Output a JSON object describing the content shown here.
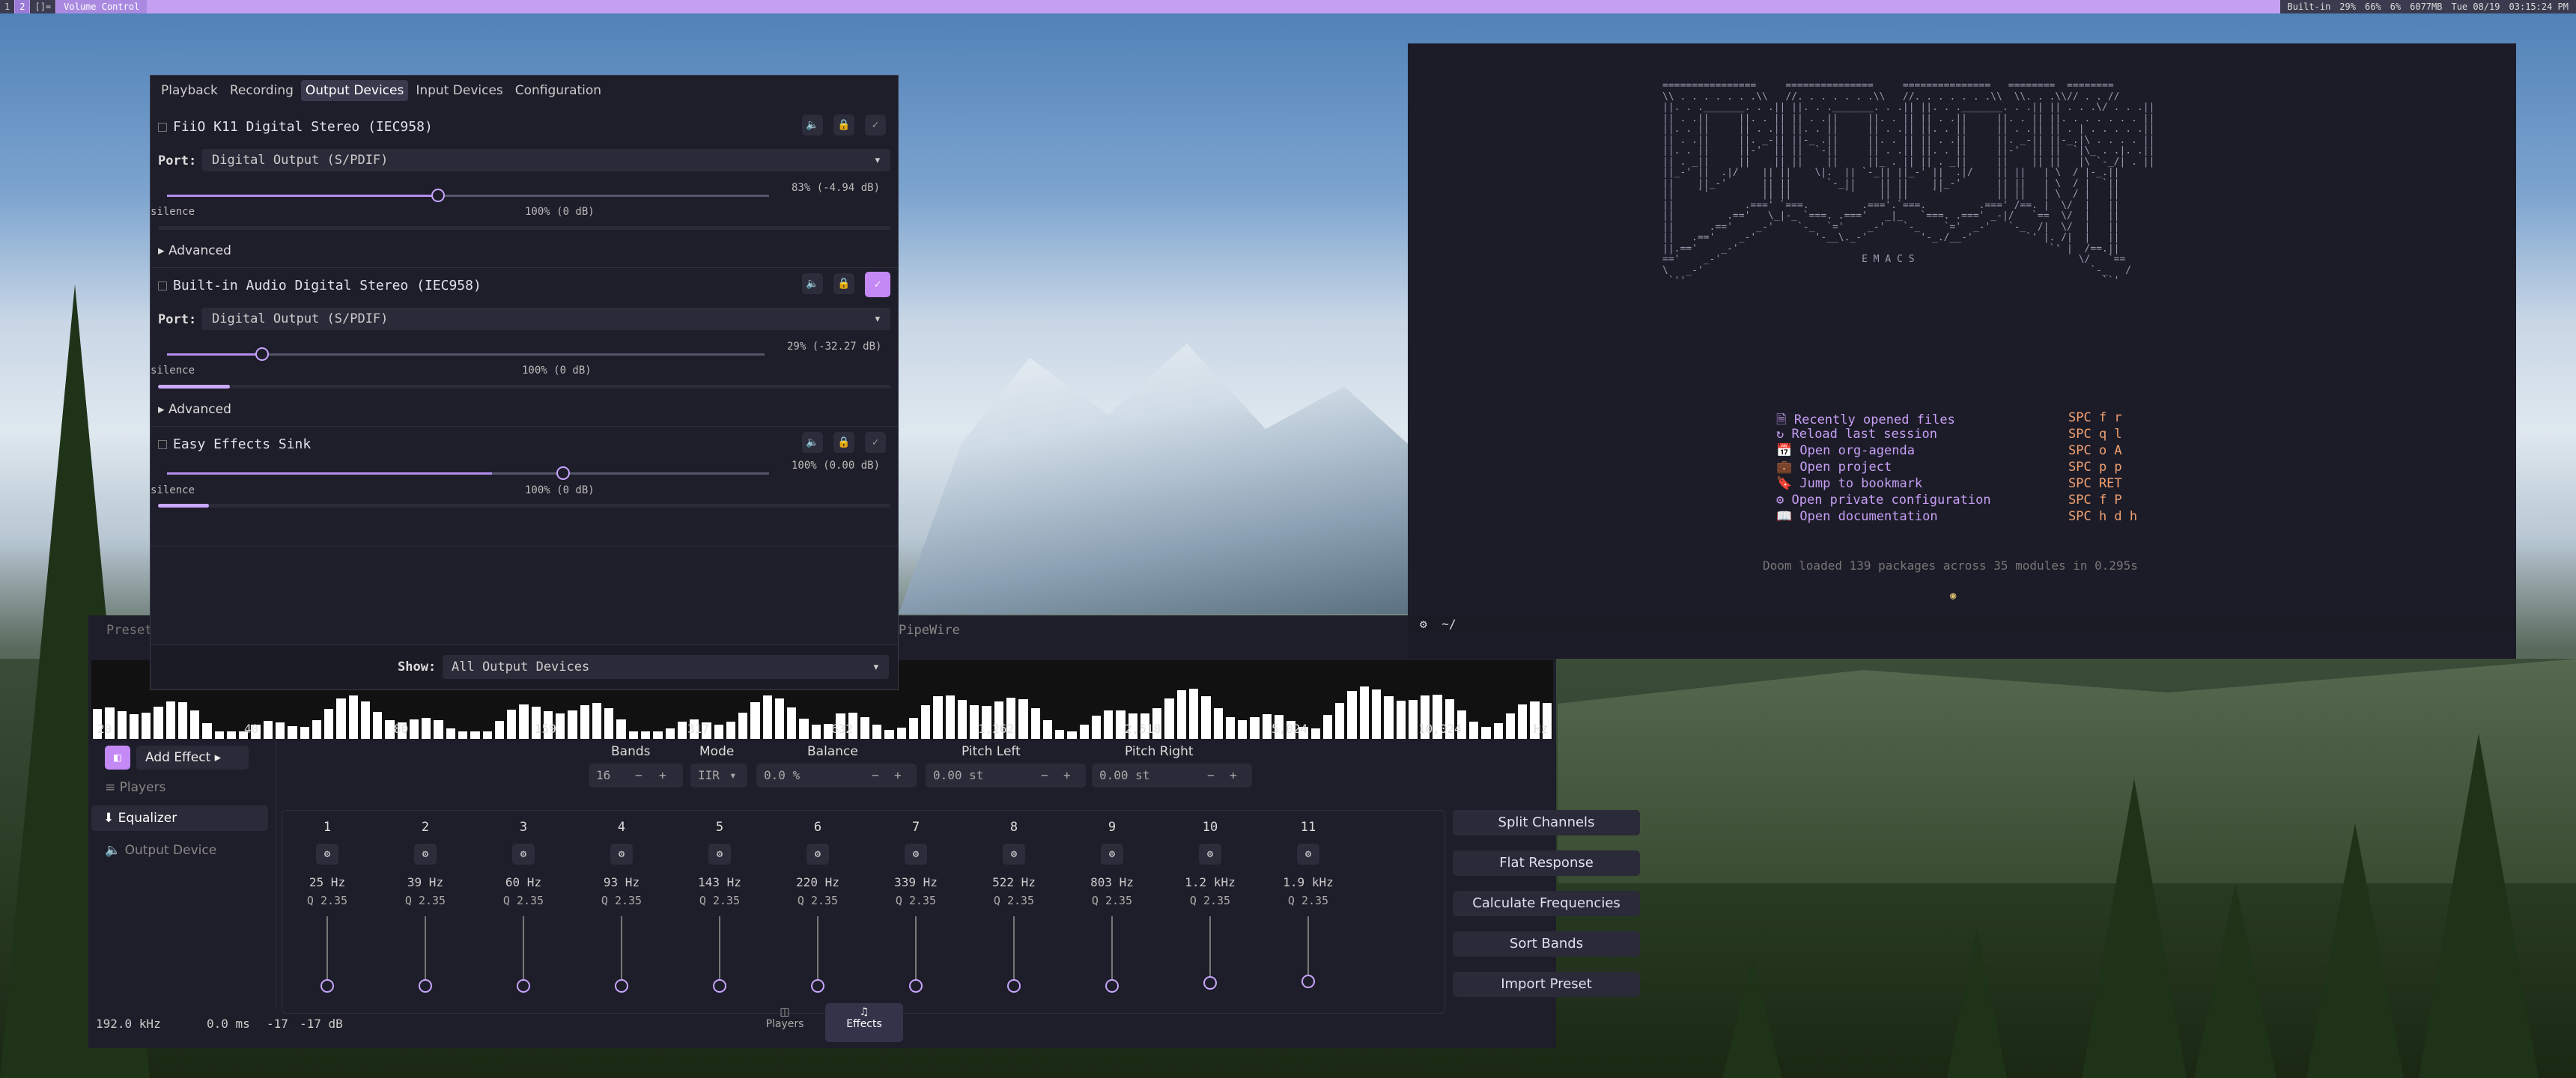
{
  "topbar": {
    "workspaces": [
      "1",
      "2",
      "[]="
    ],
    "active_workspace": "2",
    "window_title": "Volume Control",
    "status": {
      "audio": "Built-in",
      "volume": "29%",
      "brightness": "66%",
      "cpu": "6%",
      "memory": "6077MB",
      "date": "Tue 08/19",
      "time": "03:15:24 PM"
    }
  },
  "volume": {
    "tabs": [
      "Playback",
      "Recording",
      "Output Devices",
      "Input Devices",
      "Configuration"
    ],
    "active_tab": "Output Devices",
    "devices": [
      {
        "name": "FiiO K11 Digital Stereo (IEC958)",
        "port_label": "Port:",
        "port": "Digital Output (S/PDIF)",
        "volume_text": "83% (-4.94 dB)",
        "level": 0.83,
        "silence": "silence",
        "ref": "100% (0 dB)",
        "advanced": "Advanced",
        "default": false
      },
      {
        "name": "Built-in Audio Digital Stereo (IEC958)",
        "port_label": "Port:",
        "port": "Digital Output (S/PDIF)",
        "volume_text": "29% (-32.27 dB)",
        "level": 0.29,
        "silence": "silence",
        "ref": "100% (0 dB)",
        "advanced": "Advanced",
        "default": true
      },
      {
        "name": "Easy Effects Sink",
        "volume_text": "100% (0.00 dB)",
        "level": 1.0,
        "silence": "silence",
        "ref": "100% (0 dB)",
        "default": false
      }
    ],
    "show_label": "Show:",
    "show_value": "All Output Devices"
  },
  "emacs": {
    "banner_label": "E M A C S",
    "menu": [
      {
        "label": "Recently opened files",
        "key": "SPC f r",
        "icon": "file-icon"
      },
      {
        "label": "Reload last session",
        "key": "SPC q l",
        "icon": "history-icon"
      },
      {
        "label": "Open org-agenda",
        "key": "SPC o A",
        "icon": "calendar-icon"
      },
      {
        "label": "Open project",
        "key": "SPC p p",
        "icon": "briefcase-icon"
      },
      {
        "label": "Jump to bookmark",
        "key": "SPC RET",
        "icon": "bookmark-icon"
      },
      {
        "label": "Open private configuration",
        "key": "SPC f P",
        "icon": "tools-icon"
      },
      {
        "label": "Open documentation",
        "key": "SPC h d h",
        "icon": "book-icon"
      }
    ],
    "loaded": "Doom loaded 139 packages across 35 modules in 0.295s",
    "modeline_path": "~/"
  },
  "easyeffects": {
    "header_left": "Preset",
    "header_right": "PipeWire",
    "freq_labels": [
      "20",
      "40",
      "80",
      "159",
      "317",
      "632",
      "1,262",
      "2,518",
      "5,024",
      "10,024",
      "Hz"
    ],
    "add_effect": "Add Effect",
    "sidebar": [
      "Players",
      "Equalizer",
      "Output Device"
    ],
    "active_sidebar": "Equalizer",
    "controls": {
      "bands_label": "Bands",
      "bands_value": "16",
      "mode_label": "Mode",
      "mode_value": "IIR",
      "balance_label": "Balance",
      "balance_value": "0.0 %",
      "pitch_left_label": "Pitch Left",
      "pitch_left_value": "0.00 st",
      "pitch_right_label": "Pitch Right",
      "pitch_right_value": "0.00 st"
    },
    "bands": [
      {
        "n": "1",
        "hz": "25 Hz",
        "q": "Q 2.35"
      },
      {
        "n": "2",
        "hz": "39 Hz",
        "q": "Q 2.35"
      },
      {
        "n": "3",
        "hz": "60 Hz",
        "q": "Q 2.35"
      },
      {
        "n": "4",
        "hz": "93 Hz",
        "q": "Q 2.35"
      },
      {
        "n": "5",
        "hz": "143 Hz",
        "q": "Q 2.35"
      },
      {
        "n": "6",
        "hz": "220 Hz",
        "q": "Q 2.35"
      },
      {
        "n": "7",
        "hz": "339 Hz",
        "q": "Q 2.35"
      },
      {
        "n": "8",
        "hz": "522 Hz",
        "q": "Q 2.35"
      },
      {
        "n": "9",
        "hz": "803 Hz",
        "q": "Q 2.35"
      },
      {
        "n": "10",
        "hz": "1.2 kHz",
        "q": "Q 2.35"
      },
      {
        "n": "11",
        "hz": "1.9 kHz",
        "q": "Q 2.35"
      }
    ],
    "actions": [
      "Split Channels",
      "Flat Response",
      "Calculate Frequencies",
      "Sort Bands",
      "Import Preset"
    ],
    "status": {
      "rate": "192.0 kHz",
      "latency": "0.0 ms",
      "peak_l": "-17",
      "peak_r": "-17 dB"
    },
    "bottom_tabs": [
      "Players",
      "Effects"
    ],
    "active_bottom_tab": "Effects"
  }
}
